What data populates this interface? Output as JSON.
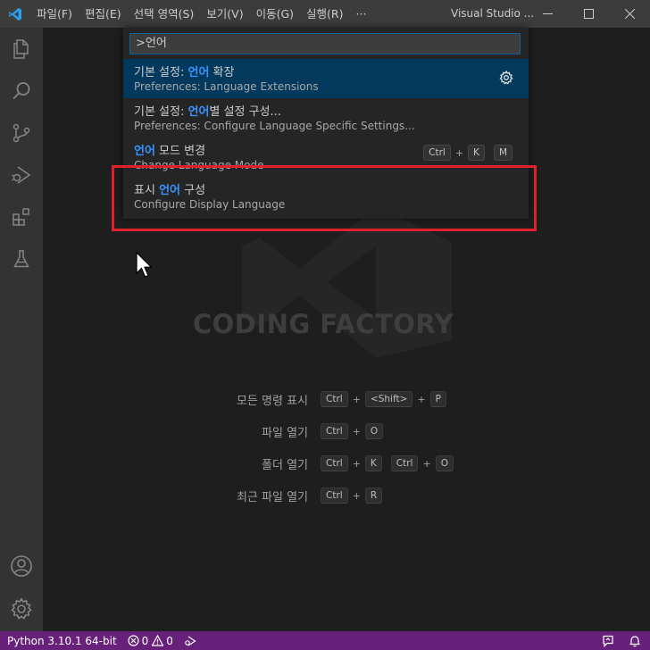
{
  "window": {
    "title": "Visual Studio ...",
    "controls": [
      "minimize",
      "maximize",
      "close"
    ]
  },
  "menu": {
    "items": [
      "파일(F)",
      "편집(E)",
      "선택 영역(S)",
      "보기(V)",
      "이동(G)",
      "실행(R)"
    ],
    "overflow": "···"
  },
  "activity_bar": {
    "top_icons": [
      "explorer-icon",
      "search-icon",
      "source-control-icon",
      "run-debug-icon",
      "extensions-icon",
      "testing-icon"
    ],
    "bottom_icons": [
      "accounts-icon",
      "manage-gear-icon"
    ]
  },
  "command_palette": {
    "input_value": ">언어",
    "items": [
      {
        "title_before": "기본 설정: ",
        "title_hl": "언어",
        "title_after": " 확장",
        "subtitle": "Preferences: Language Extensions",
        "selected": true,
        "gear": true
      },
      {
        "title_before": "기본 설정: ",
        "title_hl": "언어",
        "title_after": "별 설정 구성...",
        "subtitle": "Preferences: Configure Language Specific Settings...",
        "selected": false
      },
      {
        "title_before": "",
        "title_hl": "언어",
        "title_after": " 모드 변경",
        "subtitle": "Change Language Mode",
        "selected": false,
        "keys": [
          "Ctrl",
          "+",
          "K",
          "M"
        ]
      },
      {
        "title_before": "표시 ",
        "title_hl": "언어",
        "title_after": " 구성",
        "subtitle": "Configure Display Language",
        "selected": false
      }
    ]
  },
  "watermark": {
    "text": "CODING FACTORY"
  },
  "shortcuts": [
    {
      "label": "모든 명령 표시",
      "keys": [
        "Ctrl",
        "<Shift>",
        "P"
      ]
    },
    {
      "label": "파일 열기",
      "keys": [
        "Ctrl",
        "O"
      ]
    },
    {
      "label": "폴더 열기",
      "keys": [
        "Ctrl",
        "K"
      ],
      "keys2": [
        "Ctrl",
        "O"
      ]
    },
    {
      "label": "최근 파일 열기",
      "keys": [
        "Ctrl",
        "R"
      ]
    }
  ],
  "status_bar": {
    "python": "Python 3.10.1 64-bit",
    "errors": "0",
    "warnings": "0",
    "color": "#68217a"
  },
  "colors": {
    "accent": "#3794ff",
    "selection": "#04395e",
    "highlight_box": "#e0202a"
  }
}
